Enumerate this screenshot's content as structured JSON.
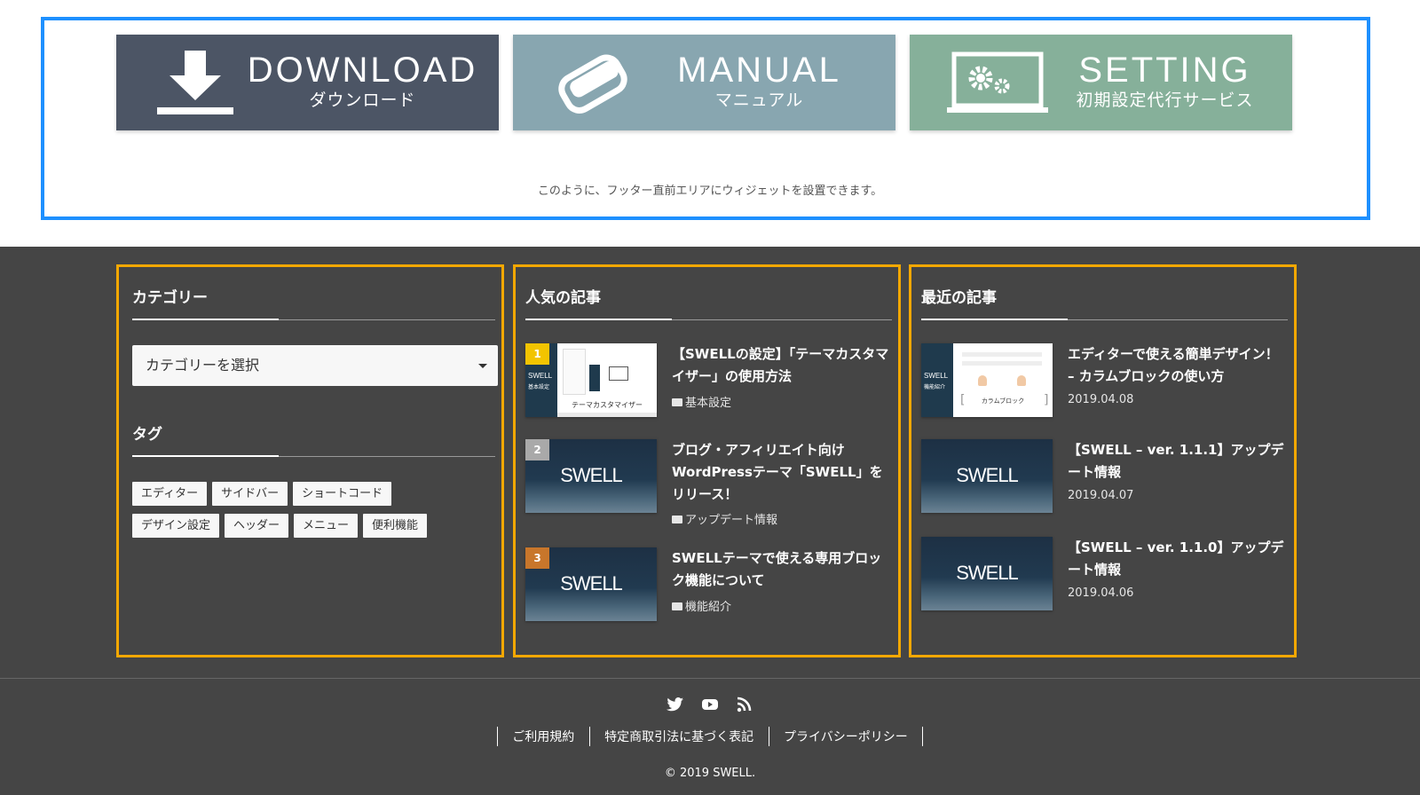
{
  "banners": [
    {
      "title": "DOWNLOAD",
      "subtitle": "ダウンロード",
      "icon": "download-icon",
      "color": "#4c5565"
    },
    {
      "title": "MANUAL",
      "subtitle": "マニュアル",
      "icon": "book-icon",
      "color": "#88a6b0"
    },
    {
      "title": "SETTING",
      "subtitle": "初期設定代行サービス",
      "icon": "settings-monitor-icon",
      "color": "#86b09a"
    }
  ],
  "top_note": "このように、フッター直前エリアにウィジェットを設置できます。",
  "widgets": {
    "category": {
      "title": "カテゴリー",
      "select_placeholder": "カテゴリーを選択"
    },
    "tags": {
      "title": "タグ",
      "items": [
        "エディター",
        "サイドバー",
        "ショートコード",
        "デザイン設定",
        "ヘッダー",
        "メニュー",
        "便利機能"
      ]
    },
    "popular": {
      "title": "人気の記事",
      "posts": [
        {
          "rank": "1",
          "title": "【SWELLの設定】「テーマカスタマイザー」の使用方法",
          "category": "基本設定",
          "thumb_caption": "テーマカスタマイザー",
          "thumb_side": "SWELL",
          "thumb_side_sub": "基本設定"
        },
        {
          "rank": "2",
          "title": "ブログ・アフィリエイト向けWordPressテーマ「SWELL」をリリース！",
          "category": "アップデート情報",
          "thumb_caption": "SWELL"
        },
        {
          "rank": "3",
          "title": "SWELLテーマで使える専用ブロック機能について",
          "category": "機能紹介",
          "thumb_caption": "SWELL"
        }
      ]
    },
    "recent": {
      "title": "最近の記事",
      "posts": [
        {
          "title": "エディターで使える簡単デザイン！ – カラムブロックの使い方",
          "date": "2019.04.08",
          "thumb_caption": "カラムブロック",
          "thumb_side": "SWELL",
          "thumb_side_sub": "機能紹介"
        },
        {
          "title": "【SWELL – ver. 1.1.1】アップデート情報",
          "date": "2019.04.07",
          "thumb_caption": "SWELL"
        },
        {
          "title": "【SWELL – ver. 1.1.0】アップデート情報",
          "date": "2019.04.06",
          "thumb_caption": "SWELL"
        }
      ]
    }
  },
  "footer": {
    "social": [
      "twitter-icon",
      "youtube-icon",
      "rss-icon"
    ],
    "links": [
      "ご利用規約",
      "特定商取引法に基づく表記",
      "プライバシーポリシー"
    ],
    "copyright": "© 2019 SWELL."
  },
  "colors": {
    "top_frame": "#1e90ff",
    "widget_frame": "#f5a800",
    "footer_bg": "#454545",
    "rank1": "#f2c400",
    "rank2": "#a9a9a9",
    "rank3": "#c8762b"
  }
}
